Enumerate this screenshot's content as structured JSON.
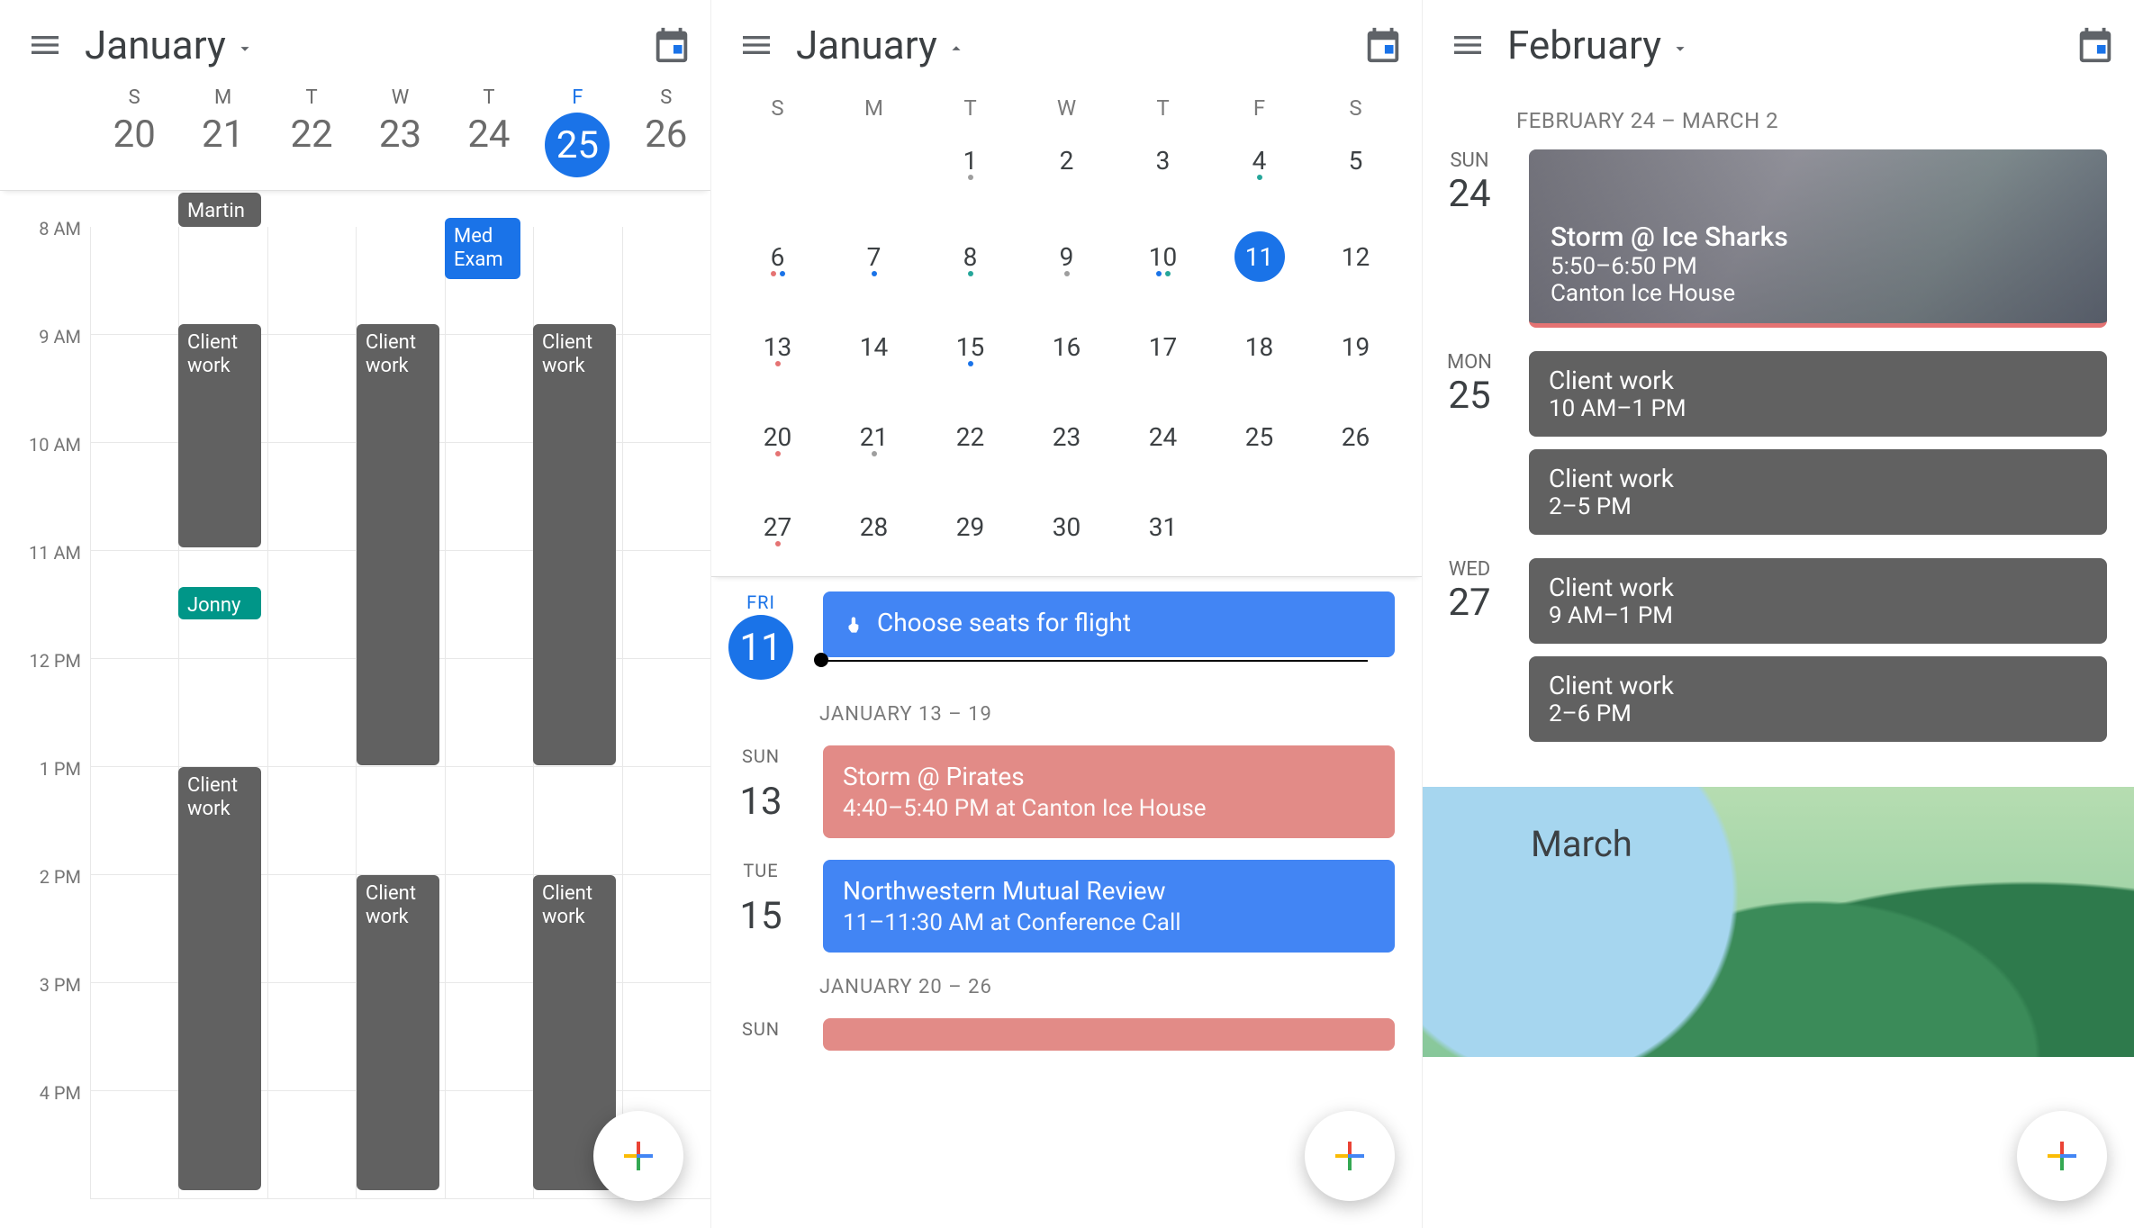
{
  "icons": {
    "plus": "plus"
  },
  "panel1": {
    "month": "January",
    "week": [
      {
        "dow": "S",
        "num": "20"
      },
      {
        "dow": "M",
        "num": "21"
      },
      {
        "dow": "T",
        "num": "22"
      },
      {
        "dow": "W",
        "num": "23"
      },
      {
        "dow": "T",
        "num": "24"
      },
      {
        "dow": "F",
        "num": "25",
        "today": true
      },
      {
        "dow": "S",
        "num": "26"
      }
    ],
    "hours": [
      "8 AM",
      "9 AM",
      "10 AM",
      "11 AM",
      "12 PM",
      "1 PM",
      "2 PM",
      "3 PM",
      "4 PM"
    ],
    "events": {
      "martin": "Martin",
      "med": "Med Exam",
      "clientMon1": "Client work",
      "clientWed1": "Client work",
      "clientFri1": "Client work",
      "jonny": "Jonny",
      "clientMon2": "Client work",
      "clientWed2": "Client work",
      "clientFri2": "Client work"
    }
  },
  "panel2": {
    "month": "January",
    "dows": [
      "S",
      "M",
      "T",
      "W",
      "T",
      "F",
      "S"
    ],
    "cells": [
      {
        "n": ""
      },
      {
        "n": ""
      },
      {
        "n": "1",
        "dots": [
          "g"
        ]
      },
      {
        "n": "2"
      },
      {
        "n": "3"
      },
      {
        "n": "4",
        "dots": [
          "t"
        ]
      },
      {
        "n": "5"
      },
      {
        "n": "6",
        "dots": [
          "r",
          "b"
        ]
      },
      {
        "n": "7",
        "dots": [
          "b"
        ]
      },
      {
        "n": "8",
        "dots": [
          "t"
        ]
      },
      {
        "n": "9",
        "dots": [
          "g"
        ]
      },
      {
        "n": "10",
        "dots": [
          "b",
          "t"
        ]
      },
      {
        "n": "11",
        "sel": true
      },
      {
        "n": "12"
      },
      {
        "n": "13",
        "dots": [
          "r"
        ]
      },
      {
        "n": "14"
      },
      {
        "n": "15",
        "dots": [
          "b"
        ]
      },
      {
        "n": "16"
      },
      {
        "n": "17"
      },
      {
        "n": "18"
      },
      {
        "n": "19"
      },
      {
        "n": "20",
        "dots": [
          "r"
        ]
      },
      {
        "n": "21",
        "dots": [
          "g"
        ]
      },
      {
        "n": "22"
      },
      {
        "n": "23"
      },
      {
        "n": "24"
      },
      {
        "n": "25"
      },
      {
        "n": "26"
      },
      {
        "n": "27",
        "dots": [
          "r"
        ]
      },
      {
        "n": "28"
      },
      {
        "n": "29"
      },
      {
        "n": "30"
      },
      {
        "n": "31"
      },
      {
        "n": ""
      },
      {
        "n": ""
      }
    ],
    "fri": {
      "dow": "FRI",
      "num": "11"
    },
    "reminder": "Choose seats for flight",
    "range1": "JANUARY 13 – 19",
    "d13": {
      "dow": "SUN",
      "num": "13",
      "title": "Storm @ Pirates",
      "sub": "4:40–5:40 PM at Canton Ice House"
    },
    "d15": {
      "dow": "TUE",
      "num": "15",
      "title": "Northwestern Mutual Review",
      "sub": "11–11:30 AM at Conference Call"
    },
    "range2": "JANUARY 20 – 26",
    "sun2": "SUN"
  },
  "panel3": {
    "month": "February",
    "range": "FEBRUARY 24 – MARCH 2",
    "d24": {
      "dow": "SUN",
      "num": "24",
      "title": "Storm @ Ice Sharks",
      "sub1": "5:50–6:50 PM",
      "sub2": "Canton Ice House"
    },
    "d25": {
      "dow": "MON",
      "num": "25",
      "e1t": "Client work",
      "e1s": "10 AM–1 PM",
      "e2t": "Client work",
      "e2s": "2–5 PM"
    },
    "d27": {
      "dow": "WED",
      "num": "27",
      "e1t": "Client work",
      "e1s": "9 AM–1 PM",
      "e2t": "Client work",
      "e2s": "2–6 PM"
    },
    "march": "March"
  }
}
